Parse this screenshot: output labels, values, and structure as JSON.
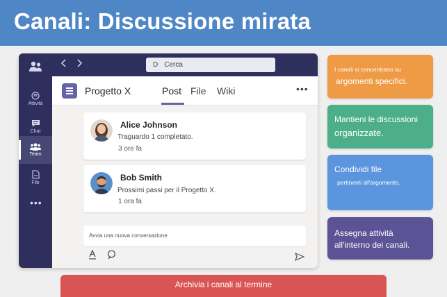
{
  "slide": {
    "title": "Canali: Discussione mirata",
    "banner_color": "#4f86c6"
  },
  "app": {
    "search": {
      "prefix": "D",
      "placeholder": "Cerca"
    },
    "rail": {
      "items": [
        {
          "label": "Attività",
          "icon": "bell-icon"
        },
        {
          "label": "Chat",
          "icon": "chat-icon"
        },
        {
          "label": "Team",
          "icon": "team-icon",
          "active": true
        },
        {
          "label": "File",
          "icon": "file-icon"
        }
      ],
      "more": "•••"
    },
    "channel": {
      "name": "Progetto X",
      "tabs": [
        "Post",
        "File",
        "Wiki"
      ],
      "active_tab": "Post",
      "more": "•••"
    },
    "posts": [
      {
        "author": "Alice Johnson",
        "message": "Traguardo 1 completato.",
        "time": "3 ore fa"
      },
      {
        "author": "Bob Smith",
        "message": "Prossimi passi per il Progetto X.",
        "time": "1 ora fa"
      }
    ],
    "compose": {
      "placeholder": "Avvia una nuova conversazione"
    }
  },
  "tips": [
    {
      "small": "I canali si concentrano su",
      "big": "argomenti specifici.",
      "color": "#ef9a45"
    },
    {
      "small": "Mantieni le discussioni",
      "big": "organizzate.",
      "color": "#4caf8a"
    },
    {
      "small": "Condividi file",
      "big": "pertinenti all'argomento.",
      "color": "#5b95de"
    },
    {
      "small": "Assegna attività",
      "big": "all'interno dei canali.",
      "color": "#5c5296"
    }
  ],
  "archive": {
    "label": "Archivia i canali al termine",
    "color": "#d95555"
  }
}
